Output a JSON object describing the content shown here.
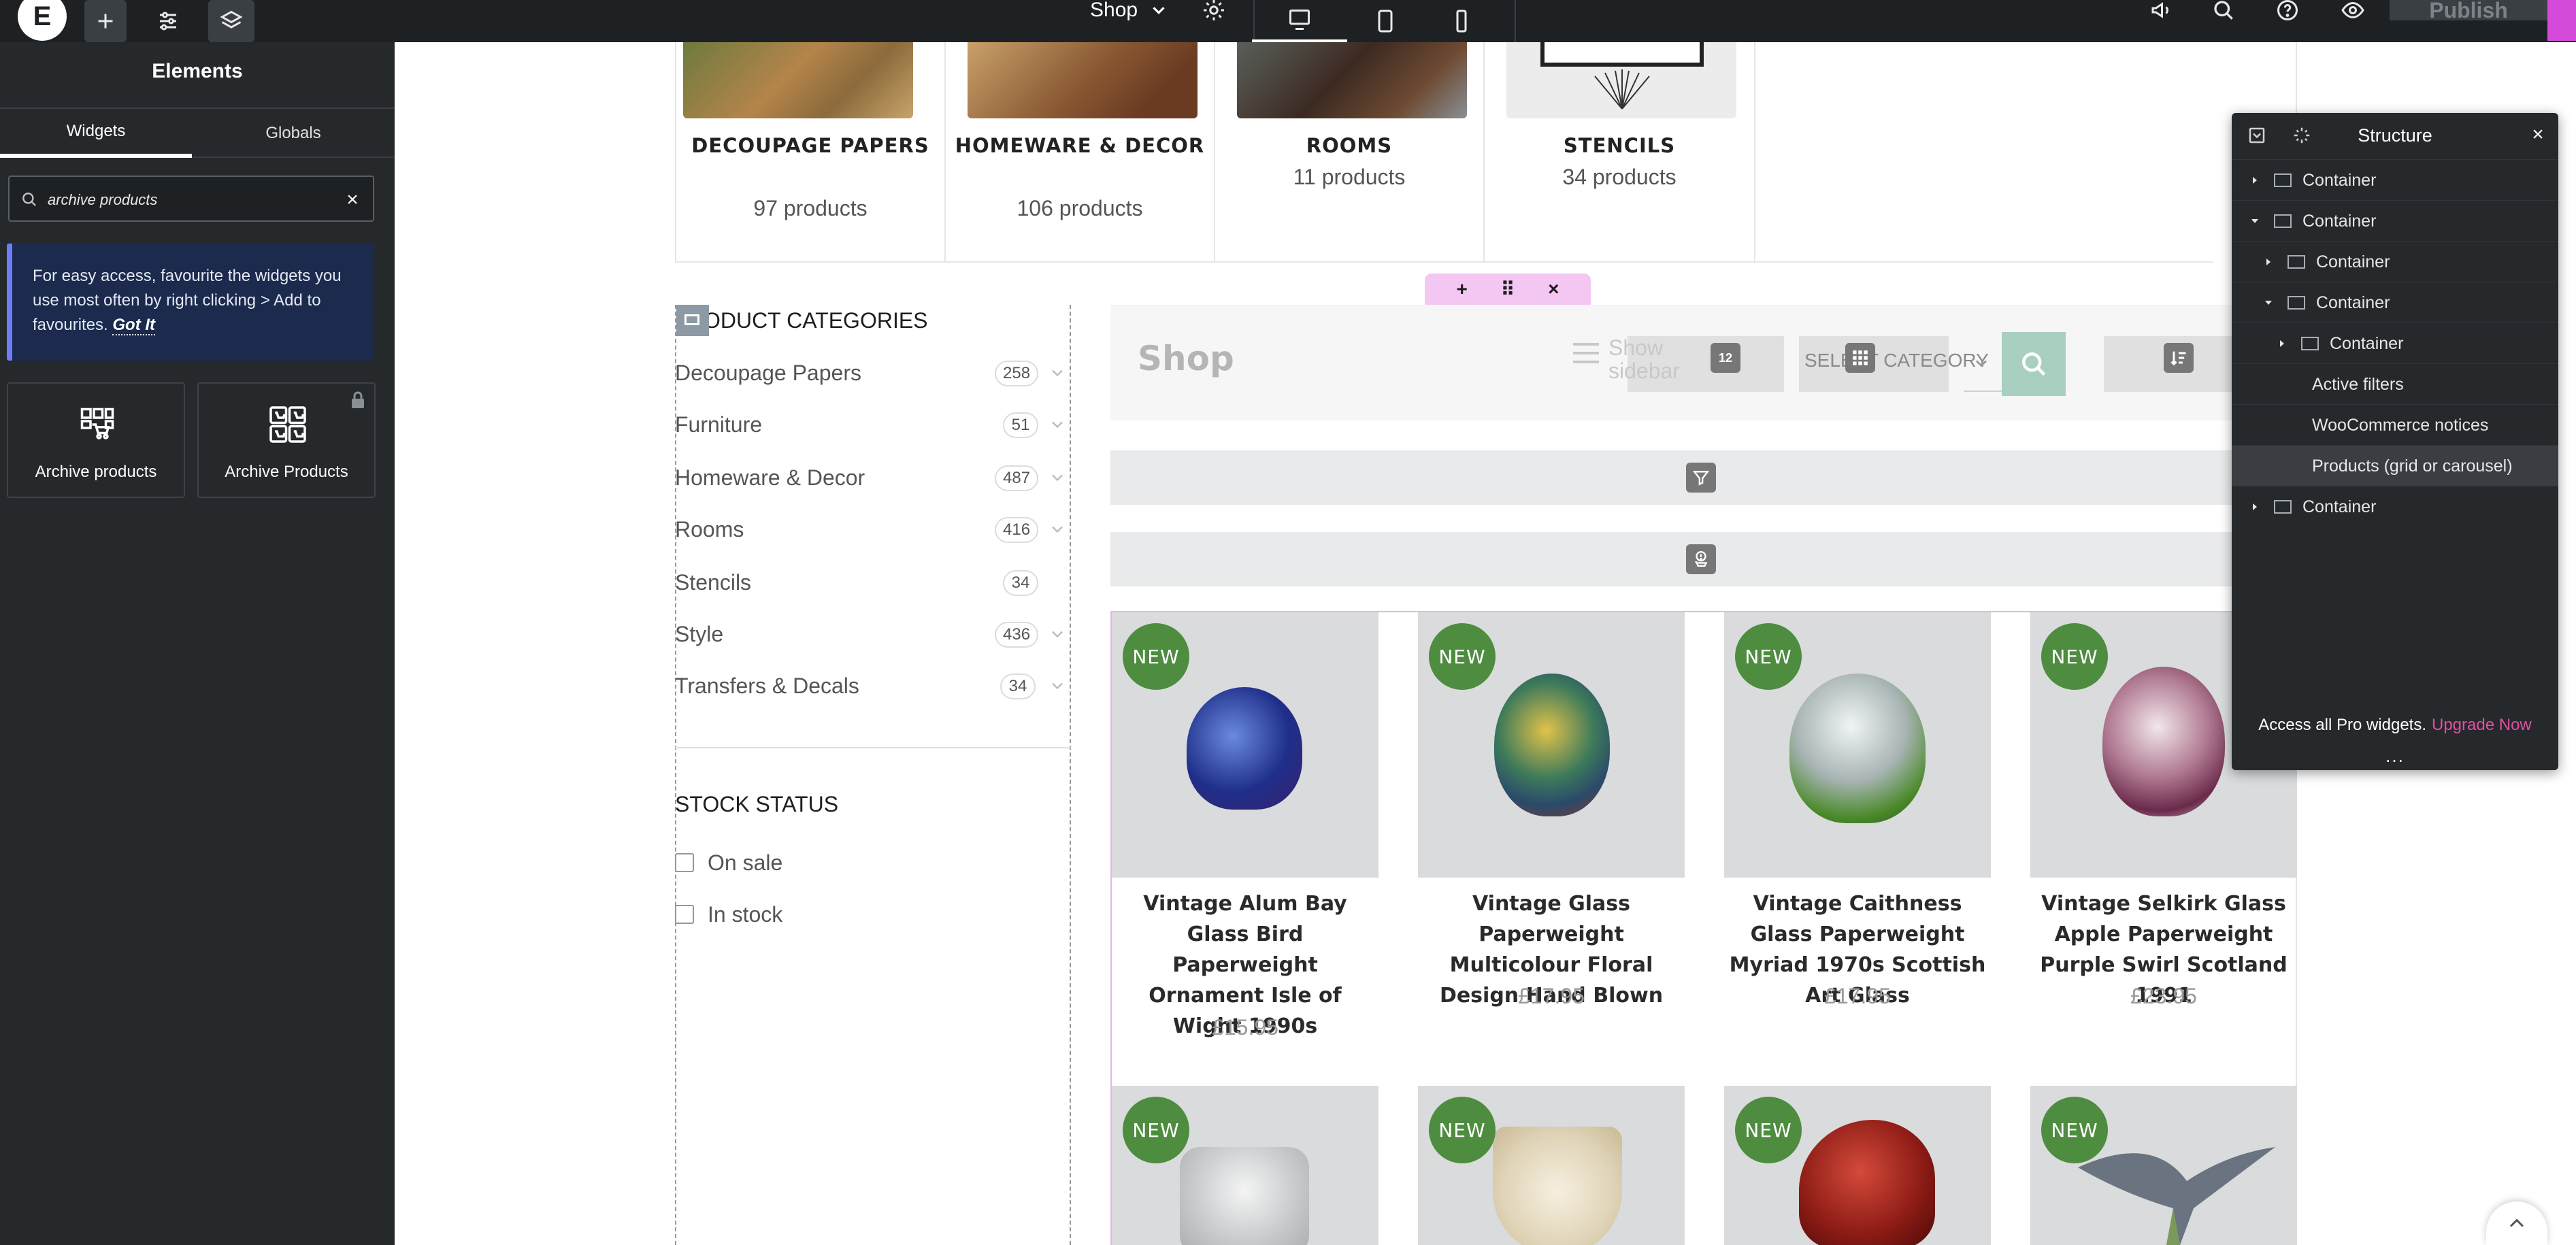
{
  "topbar": {
    "logo_glyph": "E",
    "page_name": "Shop",
    "publish_label": "Publish",
    "accent_color": "#d44ad9"
  },
  "panel": {
    "title": "Elements",
    "tabs": [
      {
        "label": "Widgets",
        "active": true
      },
      {
        "label": "Globals",
        "active": false
      }
    ],
    "search": {
      "value": "archive products",
      "clear_glyph": "×"
    },
    "notice": {
      "text": "For easy access, favourite the widgets you use most often by right clicking > Add to favourites.",
      "link": "Got It"
    },
    "widgets": [
      {
        "label": "Archive products",
        "locked": false
      },
      {
        "label": "Archive Products",
        "locked": true
      }
    ],
    "collapse_glyph": "‹"
  },
  "canvas": {
    "categories": [
      {
        "name": "DECOUPAGE PAPERS",
        "count": "97 products"
      },
      {
        "name": "HOMEWARE & DECOR",
        "count": "106 products"
      },
      {
        "name": "ROOMS",
        "count": "11 products"
      },
      {
        "name": "STENCILS",
        "count": "34 products"
      }
    ],
    "section_toolbar": {
      "add": "+",
      "move": "⠿",
      "close": "×"
    },
    "sidebar": {
      "product_categories_title": "ODUCT CATEGORIES",
      "items": [
        {
          "name": "Decoupage Papers",
          "count": "258"
        },
        {
          "name": "Furniture",
          "count": "51"
        },
        {
          "name": "Homeware & Decor",
          "count": "487"
        },
        {
          "name": "Rooms",
          "count": "416"
        },
        {
          "name": "Stencils",
          "count": "34"
        },
        {
          "name": "Style",
          "count": "436"
        },
        {
          "name": "Transfers & Decals",
          "count": "34"
        }
      ],
      "stock_status_title": "STOCK STATUS",
      "stock_options": [
        "On sale",
        "In stock"
      ]
    },
    "shop_header": {
      "title": "Shop",
      "show_sidebar": "Show sidebar",
      "ppp_badge": "12",
      "category_select": "SELECT CATEGORY"
    },
    "products": [
      {
        "badge": "NEW",
        "name": "Vintage Alum Bay Glass Bird Paperweight Ornament Isle of Wight 1990s",
        "price": "£15.95"
      },
      {
        "badge": "NEW",
        "name": "Vintage Glass Paperweight Multicolour Floral Design Hand Blown",
        "price": "£17.95"
      },
      {
        "badge": "NEW",
        "name": "Vintage Caithness Glass Paperweight Myriad 1970s Scottish Art Glass",
        "price": "£17.95"
      },
      {
        "badge": "NEW",
        "name": "Vintage Selkirk Glass Apple Paperweight Purple Swirl Scotland 1991",
        "price": "£23.95"
      },
      {
        "badge": "NEW",
        "name": "",
        "price": ""
      },
      {
        "badge": "NEW",
        "name": "",
        "price": ""
      },
      {
        "badge": "NEW",
        "name": "",
        "price": ""
      },
      {
        "badge": "NEW",
        "name": "",
        "price": ""
      }
    ]
  },
  "structure": {
    "title": "Structure",
    "close_glyph": "×",
    "rows": [
      {
        "label": "Container",
        "depth": 0,
        "arrow": "right",
        "box": true
      },
      {
        "label": "Container",
        "depth": 0,
        "arrow": "down",
        "box": true
      },
      {
        "label": "Container",
        "depth": 1,
        "arrow": "right",
        "box": true
      },
      {
        "label": "Container",
        "depth": 1,
        "arrow": "down",
        "box": true
      },
      {
        "label": "Container",
        "depth": 2,
        "arrow": "right",
        "box": true
      },
      {
        "label": "Active filters",
        "depth": 2,
        "arrow": "",
        "box": false
      },
      {
        "label": "WooCommerce notices",
        "depth": 2,
        "arrow": "",
        "box": false
      },
      {
        "label": "Products (grid or carousel)",
        "depth": 2,
        "arrow": "",
        "box": false,
        "active": true
      },
      {
        "label": "Container",
        "depth": 0,
        "arrow": "right",
        "box": true
      }
    ],
    "footer_text": "Access all Pro widgets.",
    "footer_link": "Upgrade Now",
    "dots": "..."
  }
}
